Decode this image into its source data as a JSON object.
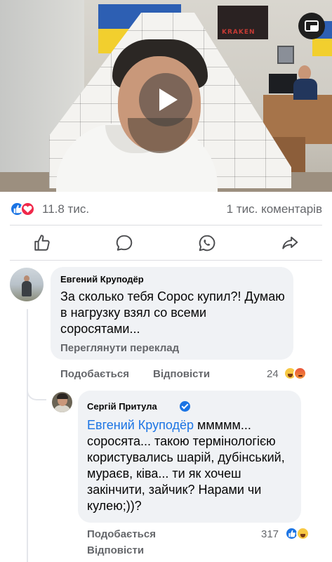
{
  "video": {
    "poster_text": "KRAKEN",
    "play_icon": "play-icon",
    "pip_icon": "picture-in-picture-icon"
  },
  "stats": {
    "reactions": [
      "like",
      "love"
    ],
    "reaction_count": "11.8 тис.",
    "comments_count": "1 тис. коментарів"
  },
  "actions": [
    {
      "icon": "thumbs-up-icon"
    },
    {
      "icon": "comment-icon"
    },
    {
      "icon": "whatsapp-icon"
    },
    {
      "icon": "share-icon"
    }
  ],
  "comments": [
    {
      "author": "Евгений Круподёр",
      "text": "За сколько тебя Сорос купил?! Думаю в нагрузку взял со всеми соросятами...",
      "translate_label": "Переглянути переклад",
      "like_label": "Подобається",
      "reply_label": "Відповісти",
      "reaction_count": "24",
      "reactions": [
        "haha",
        "angry"
      ]
    },
    {
      "author": "Сергій Притула",
      "verified": true,
      "mention": "Евгений Круподёр",
      "text": " ммммм... соросята... такою термінологією користувались шарій, дубінський, мураєв, ківа... ти як хочеш закінчити, зайчик? Нарами чи кулею;))?",
      "like_label": "Подобається",
      "reply_label": "Відповісти",
      "reaction_count": "317",
      "reactions": [
        "like",
        "haha"
      ]
    }
  ],
  "colors": {
    "accent_blue": "#1b74e4",
    "muted_text": "#65676b",
    "bubble_bg": "#f0f2f5",
    "love_red": "#f0284a"
  }
}
